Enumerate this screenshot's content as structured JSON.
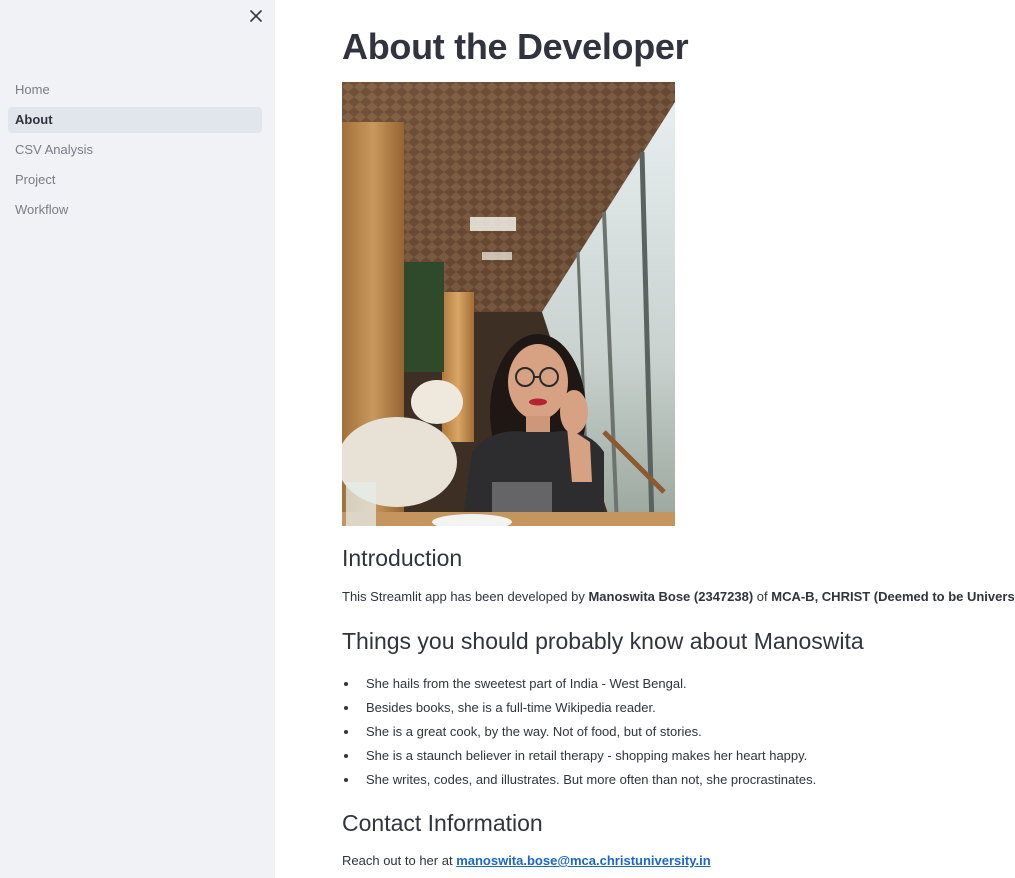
{
  "sidebar": {
    "close_icon": "close-icon",
    "items": [
      {
        "label": "Home",
        "active": false
      },
      {
        "label": "About",
        "active": true
      },
      {
        "label": "CSV Analysis",
        "active": false
      },
      {
        "label": "Project",
        "active": false
      },
      {
        "label": "Workflow",
        "active": false
      }
    ]
  },
  "main": {
    "title": "About the Developer",
    "intro": {
      "heading": "Introduction",
      "text_before": "This Streamlit app has been developed by ",
      "name": "Manoswita Bose (2347238)",
      "text_mid": " of ",
      "institution": "MCA-B, CHRIST (Deemed to be University)",
      "text_after": "."
    },
    "things": {
      "heading": "Things you should probably know about Manoswita",
      "items": [
        "She hails from the sweetest part of India - West Bengal.",
        "Besides books, she is a full-time Wikipedia reader.",
        "She is a great cook, by the way. Not of food, but of stories.",
        "She is a staunch believer in retail therapy - shopping makes her heart happy.",
        "She writes, codes, and illustrates. But more often than not, she procrastinates."
      ]
    },
    "contact": {
      "heading": "Contact Information",
      "prefix": "Reach out to her at ",
      "email": "manoswita.bose@mca.christuniversity.in"
    }
  },
  "colors": {
    "sidebar_bg": "#f0f2f6",
    "active_item_bg": "#e1e5ec",
    "text": "#31333f",
    "link": "#1c66c7"
  }
}
